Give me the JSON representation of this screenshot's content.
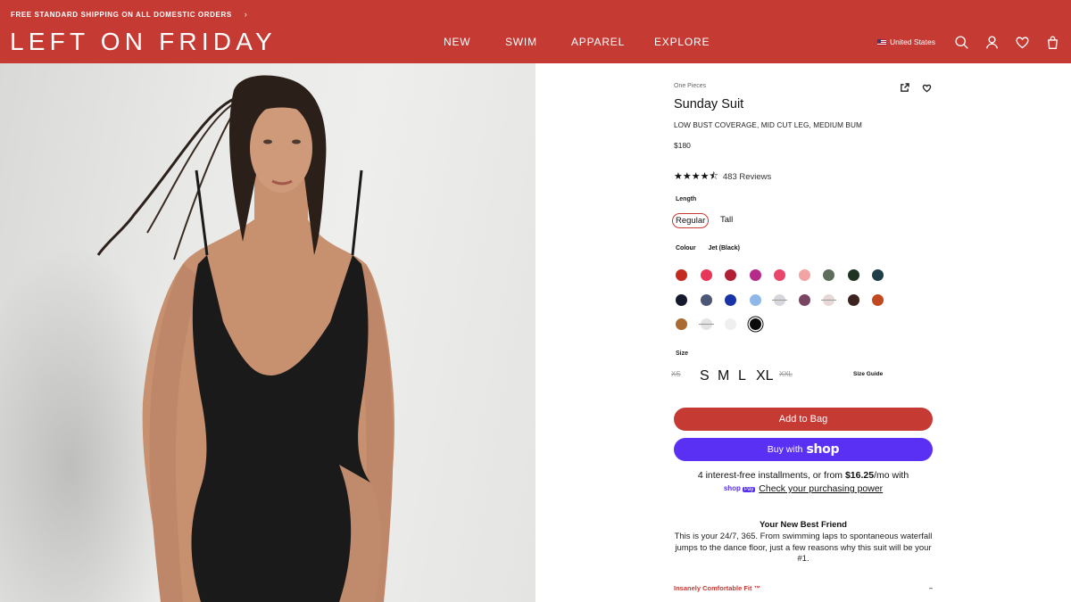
{
  "header": {
    "promo_text": "FREE STANDARD SHIPPING ON ALL DOMESTIC ORDERS",
    "promo_chevron": "›",
    "logo": "LEFT ON FRIDAY",
    "nav": [
      "NEW",
      "SWIM",
      "APPAREL",
      "EXPLORE"
    ],
    "country": "United States",
    "icons": [
      "search-icon",
      "account-icon",
      "heart-icon",
      "bag-icon"
    ],
    "bg_color": "#c63a34"
  },
  "product": {
    "breadcrumb": "One Pieces",
    "title": "Sunday Suit",
    "subtitle": "LOW BUST COVERAGE, MID CUT LEG, MEDIUM BUM",
    "price": "$180",
    "rating_stars": "★★★★⯪",
    "rating": 4.5,
    "reviews": "483 Reviews",
    "length_label": "Length",
    "length_options": [
      "Regular",
      "Tall"
    ],
    "colour_label": "Colour",
    "colour_selected": "Jet (Black)",
    "swatches": [
      {
        "color": "#c52a20",
        "oos": false
      },
      {
        "color": "#e8365a",
        "oos": false
      },
      {
        "color": "#b01f34",
        "oos": false
      },
      {
        "color": "#b62a8c",
        "oos": false
      },
      {
        "color": "#e9466c",
        "oos": false
      },
      {
        "color": "#f2a3a3",
        "oos": false
      },
      {
        "color": "#5e6d5c",
        "oos": false
      },
      {
        "color": "#1f3323",
        "oos": false
      },
      {
        "color": "#203e4a",
        "oos": false
      },
      {
        "color": "#14192e",
        "oos": false
      },
      {
        "color": "#4c5677",
        "oos": false
      },
      {
        "color": "#1833a8",
        "oos": false
      },
      {
        "color": "#8fb8e8",
        "oos": false
      },
      {
        "color": "#d6d6dc",
        "oos": true
      },
      {
        "color": "#7a4562",
        "oos": false
      },
      {
        "color": "#e7d7d7",
        "oos": true
      },
      {
        "color": "#3d2320",
        "oos": false
      },
      {
        "color": "#c1481f",
        "oos": false
      },
      {
        "color": "#a86b33",
        "oos": false
      },
      {
        "color": "#e3e3e3",
        "oos": true
      },
      {
        "color": "#efefef",
        "oos": false
      },
      {
        "color": "#0b0b0b",
        "oos": false,
        "selected": true
      }
    ],
    "size_label": "Size",
    "sizes": [
      {
        "label": "XS",
        "oos": true
      },
      {
        "label": "S",
        "oos": false
      },
      {
        "label": "M",
        "oos": false
      },
      {
        "label": "L",
        "oos": false
      },
      {
        "label": "XL",
        "oos": false
      },
      {
        "label": "XXL",
        "oos": true
      }
    ],
    "size_guide": "Size Guide",
    "add_to_bag": "Add to Bag",
    "buy_with": "Buy with",
    "shop_word": "shop",
    "install_pre": "4 interest-free installments, or from ",
    "install_amount": "$16.25",
    "install_post": "/mo with",
    "shoppay_logo": "shop",
    "shoppay_pay": "Pay",
    "shoppay_link": "Check your purchasing power",
    "bf_title": "Your New Best Friend",
    "bf_body": "This is your 24/7, 365. From swimming laps to spontaneous waterfall jumps to the dance floor, just a few reasons why this suit will be your #1.",
    "accordion_title": "Insanely Comfortable Fit ™",
    "accordion_toggle": "–"
  }
}
